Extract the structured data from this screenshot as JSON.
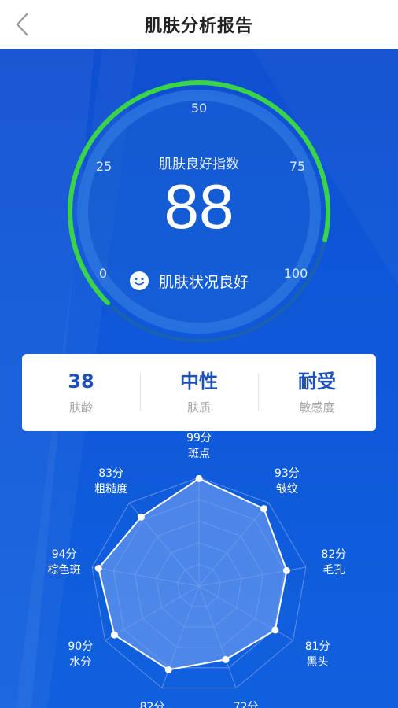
{
  "header": {
    "title": "肌肤分析报告",
    "back_icon": "chevron-left-icon"
  },
  "gauge": {
    "label": "肌肤良好指数",
    "score": "88",
    "ticks": [
      "0",
      "25",
      "50",
      "75",
      "100"
    ],
    "status_text": "肌肤状况良好",
    "status_icon": "smile-icon",
    "value_fraction": 0.88,
    "arc_color": "#3ad34a"
  },
  "stats": [
    {
      "value": "38",
      "label": "肤龄"
    },
    {
      "value": "中性",
      "label": "肤质"
    },
    {
      "value": "耐受",
      "label": "敏感度"
    }
  ],
  "radar": {
    "max": 100,
    "items": [
      {
        "score": "99分",
        "name": "斑点",
        "value": 99
      },
      {
        "score": "93分",
        "name": "皱纹",
        "value": 93
      },
      {
        "score": "82分",
        "name": "毛孔",
        "value": 82
      },
      {
        "score": "81分",
        "name": "黑头",
        "value": 81
      },
      {
        "score": "72分",
        "name": "",
        "value": 72
      },
      {
        "score": "82分",
        "name": "",
        "value": 82
      },
      {
        "score": "90分",
        "name": "水分",
        "value": 90
      },
      {
        "score": "94分",
        "name": "棕色斑",
        "value": 94
      },
      {
        "score": "83分",
        "name": "粗糙度",
        "value": 83
      }
    ]
  },
  "colors": {
    "background": "#0d4fc6",
    "card": "#ffffff",
    "stat_value": "#1f4fb8"
  }
}
